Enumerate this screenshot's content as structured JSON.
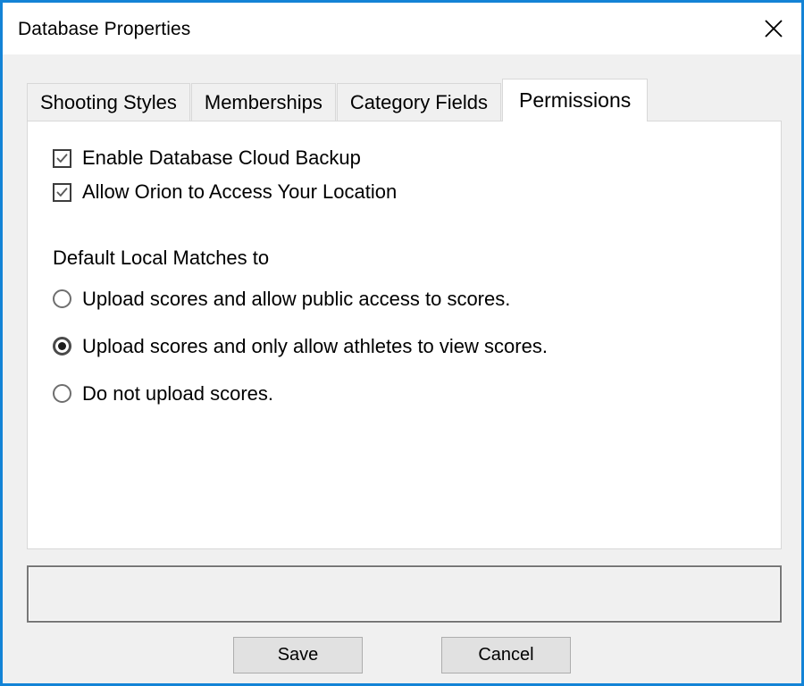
{
  "window": {
    "title": "Database Properties",
    "close_icon": "close-icon",
    "accent_color": "#1383d6",
    "titlebar_bg": "#ffffff",
    "client_bg": "#f0f0f0"
  },
  "tabs": [
    {
      "label": "Shooting Styles",
      "active": false
    },
    {
      "label": "Memberships",
      "active": false
    },
    {
      "label": "Category Fields",
      "active": false
    },
    {
      "label": "Permissions",
      "active": true
    }
  ],
  "permissions": {
    "checkboxes": [
      {
        "label": "Enable Database Cloud Backup",
        "checked": true
      },
      {
        "label": "Allow Orion to Access Your Location",
        "checked": true
      }
    ],
    "radio_group": {
      "label": "Default Local Matches to",
      "options": [
        {
          "label": "Upload scores and allow public access to scores.",
          "selected": false
        },
        {
          "label": "Upload scores and only allow athletes to view scores.",
          "selected": true
        },
        {
          "label": "Do not upload scores.",
          "selected": false
        }
      ]
    }
  },
  "status": {
    "message": ""
  },
  "footer": {
    "save_label": "Save",
    "cancel_label": "Cancel"
  }
}
